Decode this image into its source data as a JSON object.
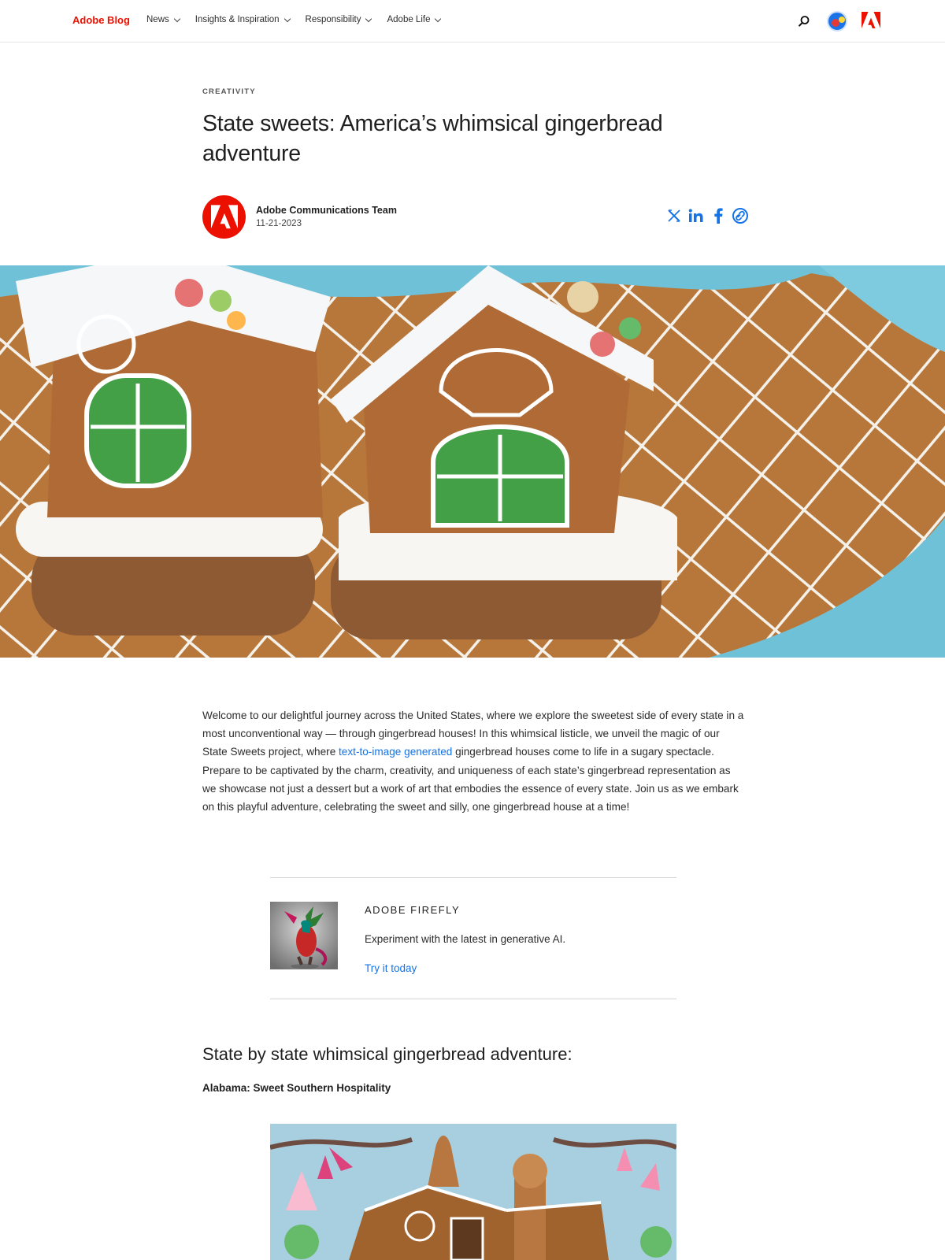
{
  "header": {
    "brand": "Adobe Blog",
    "nav": [
      "News",
      "Insights & Inspiration",
      "Responsibility",
      "Adobe Life"
    ],
    "icons": [
      "search-icon",
      "user-avatar",
      "adobe-logo-icon"
    ]
  },
  "article": {
    "category": "CREATIVITY",
    "title": "State sweets: America’s whimsical gingerbread adventure",
    "author": "Adobe Communications Team",
    "date": "11-21-2023",
    "share_icons": [
      "x-icon",
      "linkedin-icon",
      "facebook-icon",
      "copy-link-icon"
    ],
    "intro_before_link": "Welcome to our delightful journey across the United States, where we explore the sweetest side of every state in a most unconventional way — through gingerbread houses! In this whimsical listicle, we unveil the magic of our State Sweets project, where ",
    "intro_link": "text-to-image generated",
    "intro_after_link": " gingerbread houses come to life in a sugary spectacle. Prepare to be captivated by the charm, creativity, and uniqueness of each state’s gingerbread representation as we showcase not just a dessert but a work of art that embodies the essence of every state. Join us as we embark on this playful adventure, celebrating the sweet and silly, one gingerbread house at a time!"
  },
  "promo": {
    "eyebrow": "ADOBE FIREFLY",
    "description": "Experiment with the latest in generative AI.",
    "cta": "Try it today"
  },
  "section": {
    "heading": "State by state whimsical gingerbread adventure:",
    "subheading": "Alabama: Sweet Southern Hospitality"
  },
  "colors": {
    "brand_red": "#eb1000",
    "link_blue": "#1473e6"
  }
}
